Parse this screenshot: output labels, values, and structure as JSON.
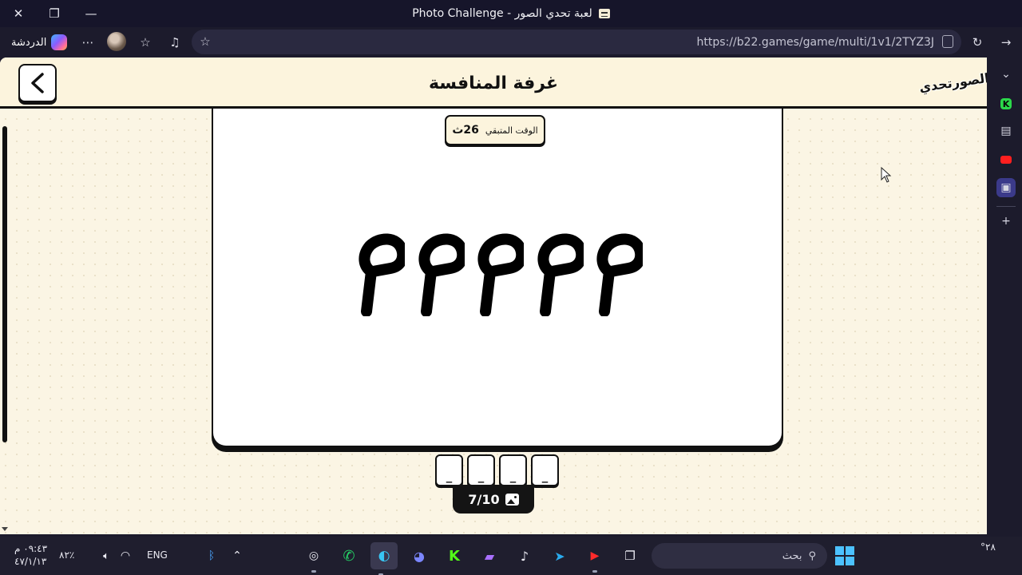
{
  "window": {
    "title": "Photo Challenge - لعبة تحدي الصور"
  },
  "toolbar": {
    "chat_label": "الدردشة",
    "url": "https://b22.games/game/multi/1v1/2TYZ3J"
  },
  "page": {
    "room_title": "غرفة المنافسة",
    "logo_text": "تحدي الصور",
    "timer": {
      "label": "الوقت المتبقي",
      "value": "26ث"
    },
    "glyphs": [
      "م",
      "م",
      "م",
      "م",
      "م"
    ],
    "answer_slots": [
      "_",
      "_",
      "_",
      "_"
    ],
    "progress": "7/10"
  },
  "taskbar": {
    "search_placeholder": "بحث",
    "language": "ENG",
    "battery": "٨٢٪",
    "time": "٠٩:٤٣ م",
    "date": "٤٧/١/١٣",
    "weather": "°٢٨"
  },
  "colors": {
    "page_bg": "#fbf5e4",
    "header_bg": "#fcf4dd",
    "ink": "#111111",
    "browser_chrome": "#1c1b2c"
  }
}
